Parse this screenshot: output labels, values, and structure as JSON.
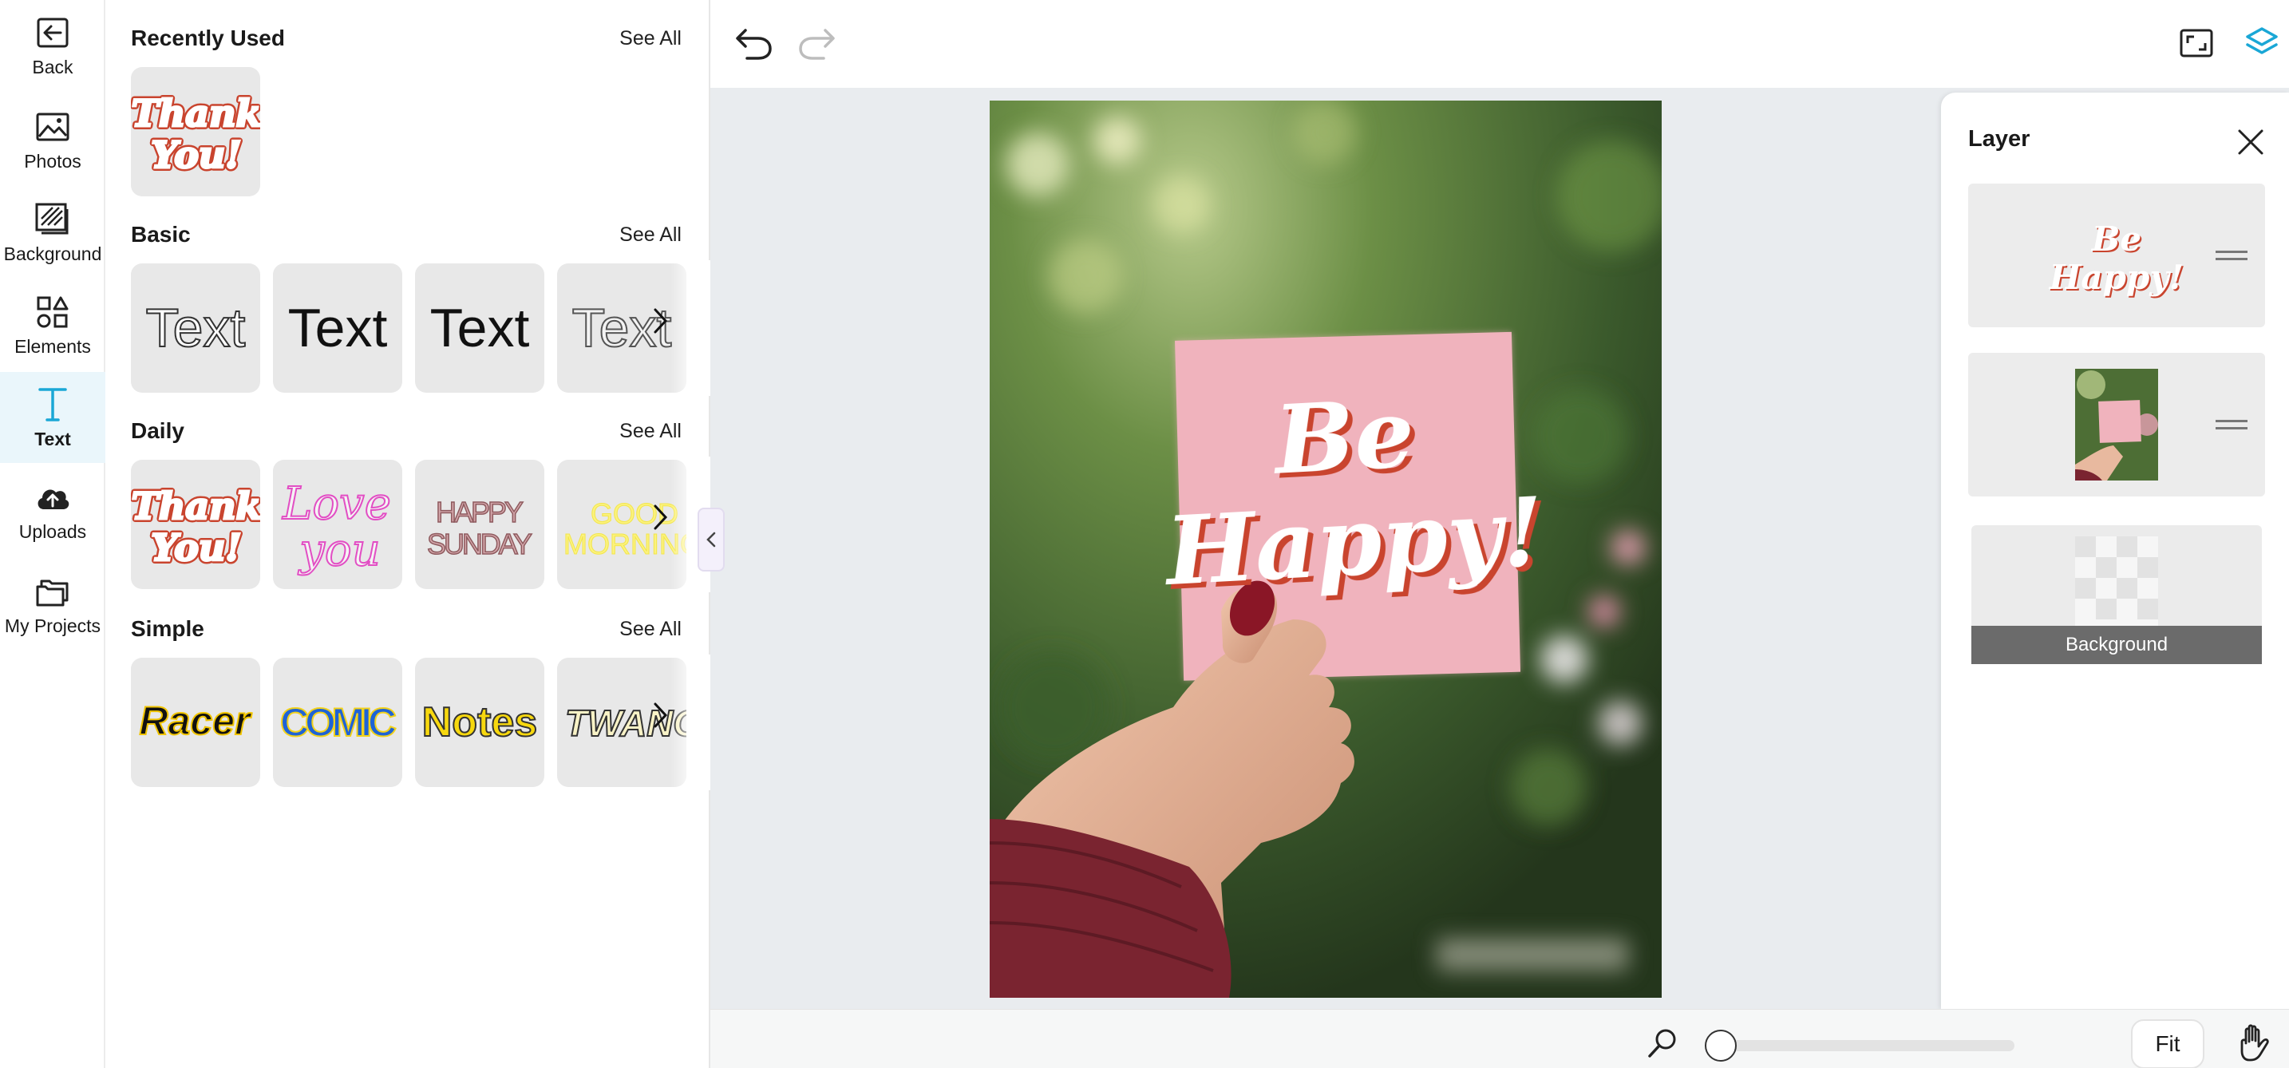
{
  "sidebar": {
    "items": [
      {
        "label": "Back",
        "icon": "back-arrow-icon"
      },
      {
        "label": "Photos",
        "icon": "photo-icon"
      },
      {
        "label": "Background",
        "icon": "background-icon"
      },
      {
        "label": "Elements",
        "icon": "shapes-icon"
      },
      {
        "label": "Text",
        "icon": "text-t-icon",
        "active": true
      },
      {
        "label": "Uploads",
        "icon": "cloud-upload-icon"
      },
      {
        "label": "My Projects",
        "icon": "folders-icon"
      }
    ]
  },
  "library": {
    "see_all": "See All",
    "recently_used": {
      "title": "Recently Used",
      "items": [
        {
          "line1": "Thank",
          "line2": "You!"
        }
      ]
    },
    "basic": {
      "title": "Basic",
      "items": [
        "Text",
        "Text",
        "Text",
        "Text"
      ]
    },
    "daily": {
      "title": "Daily",
      "items": [
        {
          "line1": "Thank",
          "line2": "You!"
        },
        {
          "line1": "Love",
          "line2": "you"
        },
        {
          "line1": "HAPPY",
          "line2": "SUNDAY"
        },
        {
          "line1": "GOOD",
          "line2": "MORNING"
        }
      ]
    },
    "simple": {
      "title": "Simple",
      "items": [
        "Racer",
        "COMIC",
        "Notes",
        "TWANG"
      ]
    }
  },
  "canvas": {
    "card_line1": "Be",
    "card_line2": "Happy!"
  },
  "layers": {
    "title": "Layer",
    "items": [
      {
        "line1": "Be",
        "line2": "Happy!"
      },
      {
        "label": ""
      },
      {
        "label": "Background"
      }
    ]
  },
  "bottom": {
    "fit_label": "Fit"
  },
  "colors": {
    "accent": "#1aa7d6",
    "active_bg": "#eaf6fb",
    "card_pink": "#f0b6bf",
    "script_shadow": "#c9442e",
    "workspace": "#e9ecef"
  }
}
